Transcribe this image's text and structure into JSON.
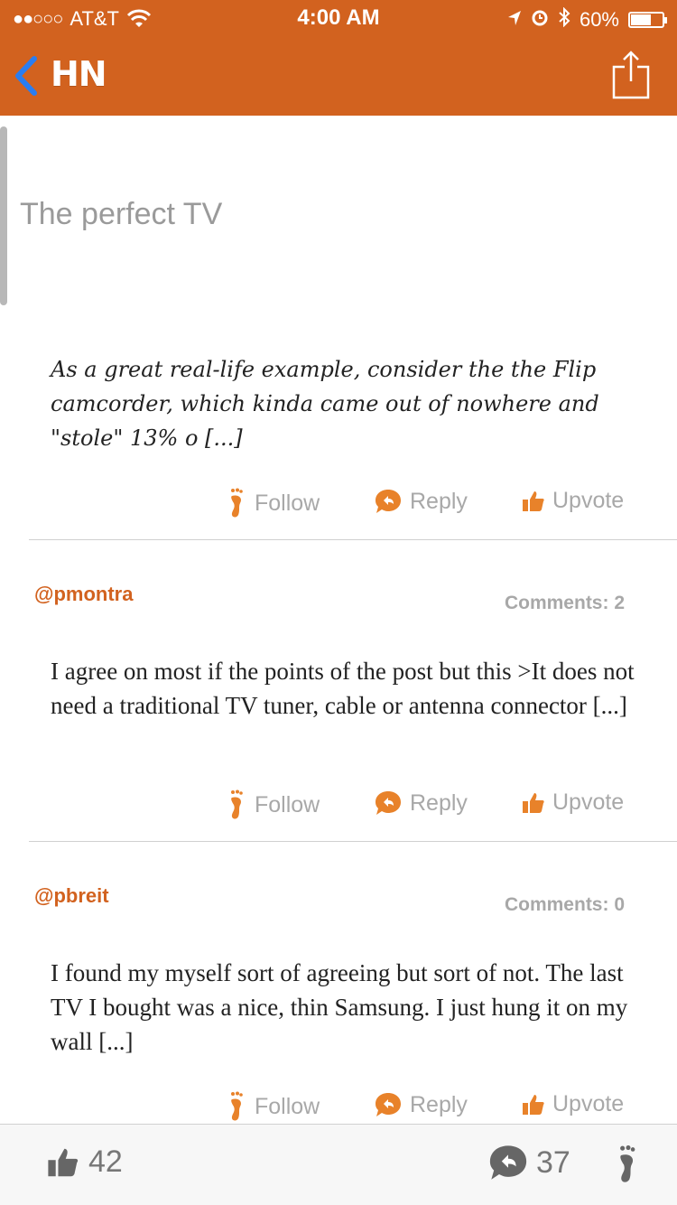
{
  "status_bar": {
    "signal": "●●○○○",
    "carrier": "AT&T",
    "time": "4:00 AM",
    "battery": "60%"
  },
  "nav": {
    "title": "HN"
  },
  "story": {
    "title": "The perfect TV"
  },
  "actions": {
    "follow": "Follow",
    "reply": "Reply",
    "upvote": "Upvote"
  },
  "comments": [
    {
      "author": "",
      "count_label": "",
      "text": "As a great real-life example, consider the the Flip camcorder, which kinda came out of nowhere and \"stole\" 13% o [...]"
    },
    {
      "author": "@pmontra",
      "count_label": "Comments: 2",
      "text": "I agree on most if the points of the post but this >It does not need a traditional TV tuner, cable or antenna connector [...]"
    },
    {
      "author": "@pbreit",
      "count_label": "Comments: 0",
      "text": "I found my myself sort of agreeing but sort of not. The last TV I bought was a nice, thin Samsung. I just hung it on my wall [...]"
    }
  ],
  "bottom_bar": {
    "upvotes": "42",
    "comments": "37"
  },
  "colors": {
    "accent": "#d2621f",
    "action_icon": "#e8822a",
    "muted_text": "#a8a8a8"
  },
  "icons": [
    "back-chevron-icon",
    "share-icon",
    "footprint-icon",
    "reply-bubble-icon",
    "thumbs-up-icon",
    "wifi-icon",
    "location-icon",
    "alarm-icon",
    "bluetooth-icon",
    "battery-icon"
  ]
}
